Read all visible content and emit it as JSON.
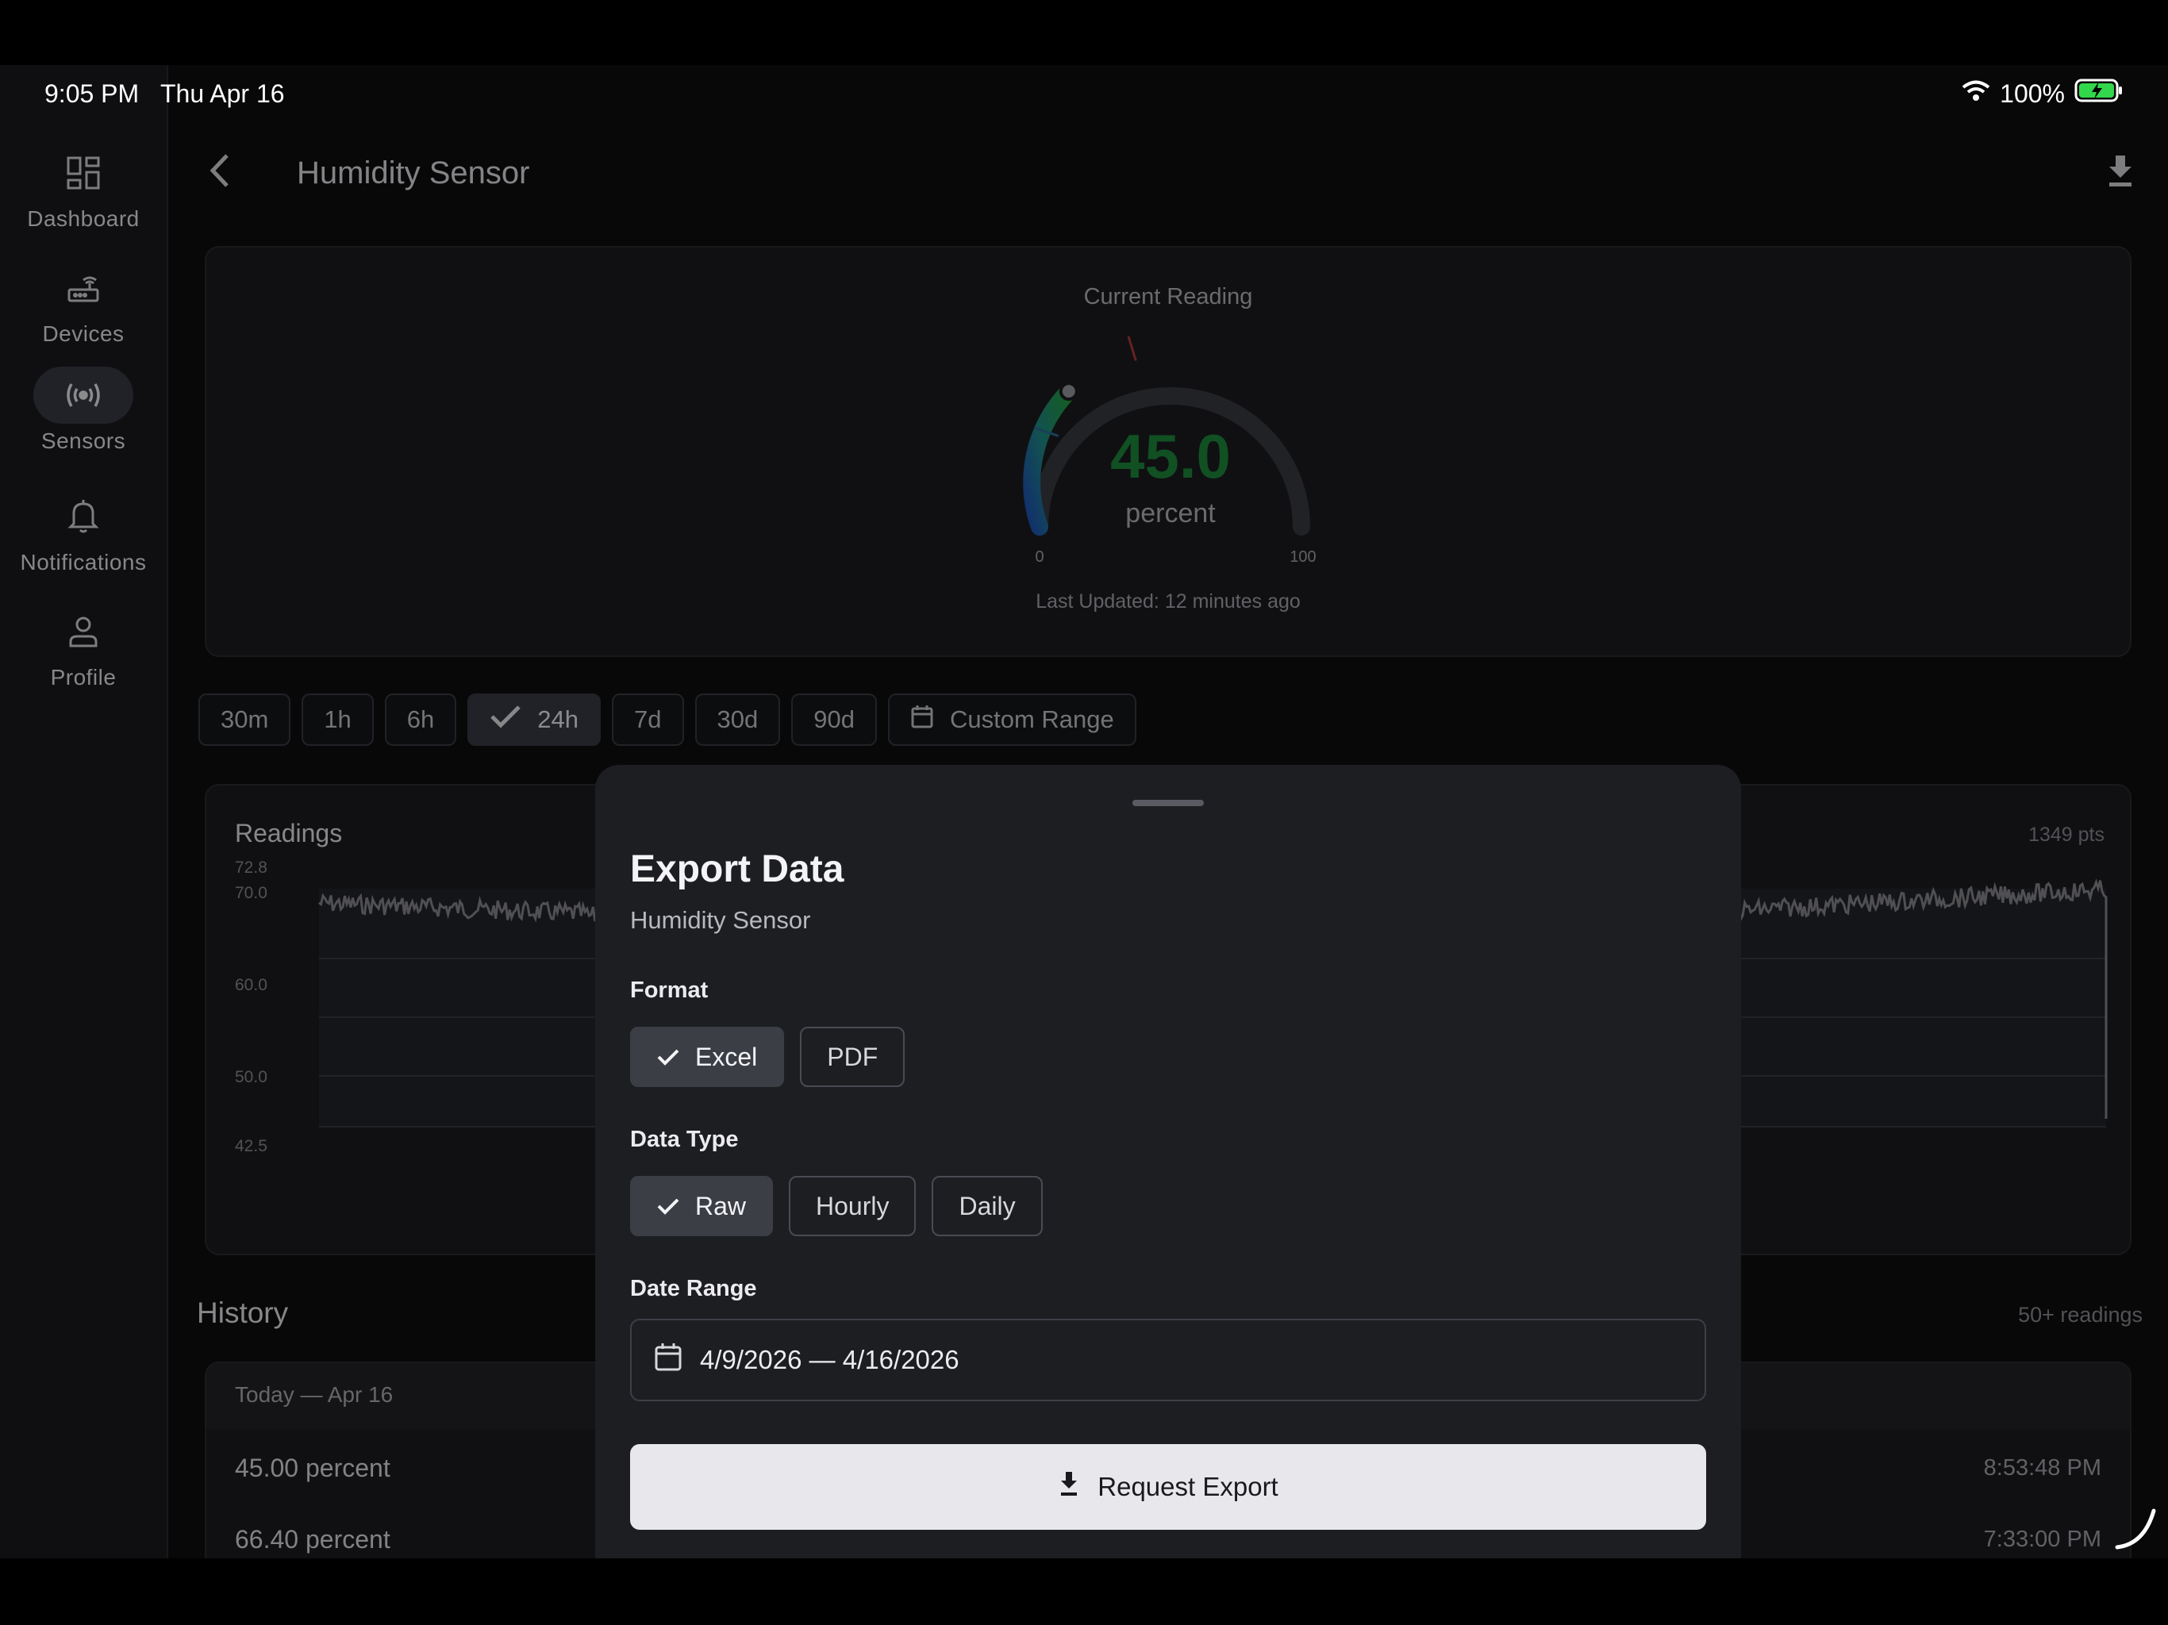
{
  "status_bar": {
    "time": "9:05 PM",
    "date": "Thu Apr 16",
    "battery": "100%"
  },
  "sidebar": {
    "items": [
      {
        "label": "Dashboard",
        "icon": "dashboard-icon",
        "active": false
      },
      {
        "label": "Devices",
        "icon": "router-icon",
        "active": false
      },
      {
        "label": "Sensors",
        "icon": "sensor-broadcast-icon",
        "active": true
      },
      {
        "label": "Notifications",
        "icon": "bell-icon",
        "active": false
      },
      {
        "label": "Profile",
        "icon": "person-icon",
        "active": false
      }
    ]
  },
  "header": {
    "title": "Humidity Sensor"
  },
  "gauge": {
    "title": "Current Reading",
    "value": "45.0",
    "unit": "percent",
    "min_label": "0",
    "max_label": "100",
    "value_fraction": 0.45,
    "updated": "Last Updated: 12 minutes ago",
    "value_color": "#1e8a3c"
  },
  "time_ranges": [
    "30m",
    "1h",
    "6h",
    "24h",
    "7d",
    "30d",
    "90d",
    "Custom Range"
  ],
  "selected_range": "24h",
  "readings": {
    "title": "Readings",
    "points": "1349 pts",
    "y_ticks": [
      "72.8",
      "70.0",
      "60.0",
      "50.0",
      "42.5"
    ]
  },
  "history": {
    "title": "History",
    "count": "50+ readings",
    "group": "Today — Apr 16",
    "rows": [
      {
        "value": "45.00 percent",
        "time": "8:53:48 PM"
      },
      {
        "value": "66.40 percent",
        "time": "7:33:00 PM"
      }
    ]
  },
  "export_sheet": {
    "title": "Export Data",
    "subtitle": "Humidity Sensor",
    "format_label": "Format",
    "formats": [
      "Excel",
      "PDF"
    ],
    "selected_format": "Excel",
    "data_type_label": "Data Type",
    "data_types": [
      "Raw",
      "Hourly",
      "Daily"
    ],
    "selected_data_type": "Raw",
    "date_range_label": "Date Range",
    "date_range": "4/9/2026 — 4/16/2026",
    "button_label": "Request Export"
  },
  "colors": {
    "accent_green": "#1e8a3c",
    "background": "#0e0e10",
    "card": "#1c1d21"
  }
}
